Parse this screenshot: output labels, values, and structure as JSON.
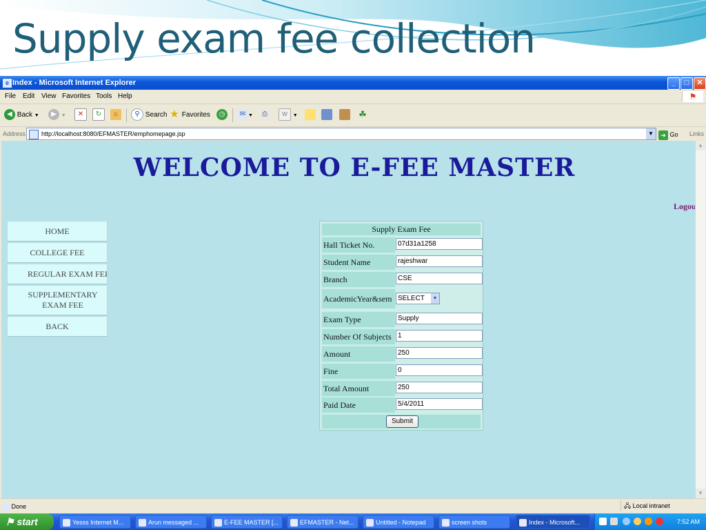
{
  "slide": {
    "title": "Supply exam fee collection"
  },
  "window": {
    "title": "Index - Microsoft Internet Explorer",
    "minimize": "_",
    "maximize": "□",
    "close": "✕"
  },
  "menu": {
    "items": [
      "File",
      "Edit",
      "View",
      "Favorites",
      "Tools",
      "Help"
    ]
  },
  "toolbar": {
    "back": "Back",
    "search": "Search",
    "favorites": "Favorites"
  },
  "address": {
    "label": "Address",
    "url": "http://localhost:8080/EFMASTER/emphomepage.jsp",
    "go": "Go",
    "links": "Links"
  },
  "page": {
    "welcome": "WELCOME TO E-FEE MASTER",
    "logout": "Logout",
    "nav": [
      "HOME",
      "COLLEGE FEE",
      "REGULAR EXAM FEE",
      "SUPPLEMENTARY EXAM FEE",
      "BACK"
    ],
    "form": {
      "heading": "Supply Exam Fee",
      "hall_ticket_label": "Hall Ticket No.",
      "hall_ticket_value": "07d31a1258",
      "student_name_label": "Student Name",
      "student_name_value": "rajeshwar",
      "branch_label": "Branch",
      "branch_value": "CSE",
      "academic_label": "AcademicYear&sem",
      "academic_value": "SELECT",
      "exam_type_label": "Exam Type",
      "exam_type_value": "Supply",
      "subjects_label": "Number Of Subjects",
      "subjects_value": "1",
      "amount_label": "Amount",
      "amount_value": "250",
      "fine_label": "Fine",
      "fine_value": "0",
      "total_label": "Total Amount",
      "total_value": "250",
      "paid_date_label": "Paid Date",
      "paid_date_value": "5/4/2011",
      "submit": "Submit"
    }
  },
  "status": {
    "text": "Done",
    "zone": "Local intranet"
  },
  "taskbar": {
    "start": "start",
    "tasks": [
      "Yesss Internet M...",
      "Arun messaged ...",
      "E-FEE MASTER [...",
      "EFMASTER - Net...",
      "Untitled - Notepad",
      "screen shots",
      "Index - Microsoft..."
    ],
    "clock": "7:52 AM"
  },
  "colors": {
    "page_background": "#b8e2ea",
    "welcome_text": "#1a1a9a",
    "logout_text": "#7a1a6e",
    "title_text": "#1f5f78"
  }
}
